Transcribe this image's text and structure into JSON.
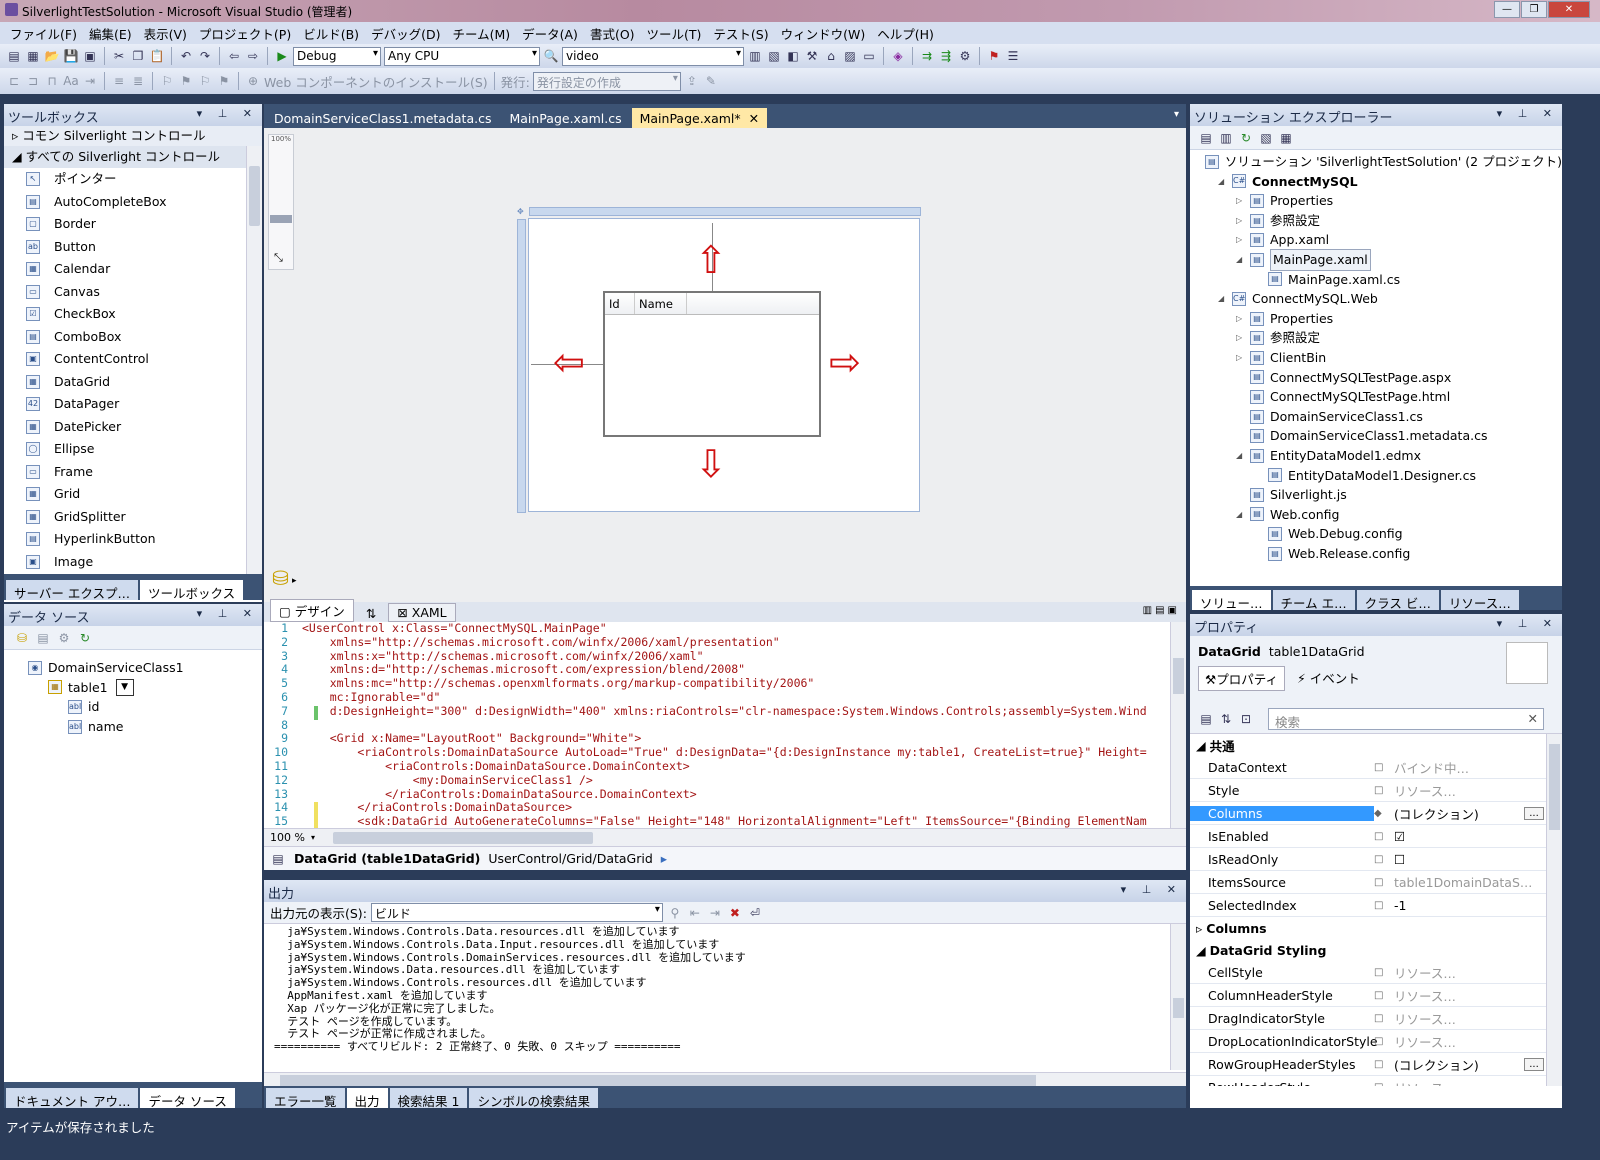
{
  "window": {
    "title": "SilverlightTestSolution - Microsoft Visual Studio (管理者)"
  },
  "menu": [
    "ファイル(F)",
    "編集(E)",
    "表示(V)",
    "プロジェクト(P)",
    "ビルド(B)",
    "デバッグ(D)",
    "チーム(M)",
    "データ(A)",
    "書式(O)",
    "ツール(T)",
    "テスト(S)",
    "ウィンドウ(W)",
    "ヘルプ(H)"
  ],
  "toolbar": {
    "config": "Debug",
    "platform": "Any CPU",
    "find": "video",
    "web_install": "Web コンポーネントのインストール(S)",
    "publish_label": "発行:",
    "publish_combo": "発行設定の作成"
  },
  "toolbox": {
    "title": "ツールボックス",
    "groups": [
      "コモン Silverlight コントロール",
      "すべての Silverlight コントロール"
    ],
    "items": [
      "ポインター",
      "AutoCompleteBox",
      "Border",
      "Button",
      "Calendar",
      "Canvas",
      "CheckBox",
      "ComboBox",
      "ContentControl",
      "DataGrid",
      "DataPager",
      "DatePicker",
      "Ellipse",
      "Frame",
      "Grid",
      "GridSplitter",
      "HyperlinkButton",
      "Image"
    ],
    "tabs": [
      "サーバー エクスプ…",
      "ツールボックス"
    ]
  },
  "datasource": {
    "title": "データ ソース",
    "tree": [
      "DomainServiceClass1",
      "table1",
      "id",
      "name"
    ],
    "tabs": [
      "ドキュメント アウ…",
      "データ ソース"
    ]
  },
  "editor": {
    "tabs": [
      "DomainServiceClass1.metadata.cs",
      "MainPage.xaml.cs",
      "MainPage.xaml*"
    ],
    "zoom_ruler": "100%",
    "grid_headers": [
      "Id",
      "Name"
    ],
    "view_tabs": [
      "デザイン",
      "⇅",
      "XAML"
    ],
    "zoom": "100 %",
    "lines": [
      {
        "n": "1",
        "t": "<UserControl x:Class=\"ConnectMySQL.MainPage\""
      },
      {
        "n": "2",
        "t": "    xmlns=\"http://schemas.microsoft.com/winfx/2006/xaml/presentation\""
      },
      {
        "n": "3",
        "t": "    xmlns:x=\"http://schemas.microsoft.com/winfx/2006/xaml\""
      },
      {
        "n": "4",
        "t": "    xmlns:d=\"http://schemas.microsoft.com/expression/blend/2008\""
      },
      {
        "n": "5",
        "t": "    xmlns:mc=\"http://schemas.openxmlformats.org/markup-compatibility/2006\""
      },
      {
        "n": "6",
        "t": "    mc:Ignorable=\"d\""
      },
      {
        "n": "7",
        "t": "    d:DesignHeight=\"300\" d:DesignWidth=\"400\" xmlns:riaControls=\"clr-namespace:System.Windows.Controls;assembly=System.Wind"
      },
      {
        "n": "8",
        "t": ""
      },
      {
        "n": "9",
        "t": "    <Grid x:Name=\"LayoutRoot\" Background=\"White\">"
      },
      {
        "n": "10",
        "t": "        <riaControls:DomainDataSource AutoLoad=\"True\" d:DesignData=\"{d:DesignInstance my:table1, CreateList=true}\" Height="
      },
      {
        "n": "11",
        "t": "            <riaControls:DomainDataSource.DomainContext>"
      },
      {
        "n": "12",
        "t": "                <my:DomainServiceClass1 />"
      },
      {
        "n": "13",
        "t": "            </riaControls:DomainDataSource.DomainContext>"
      },
      {
        "n": "14",
        "t": "        </riaControls:DomainDataSource>"
      },
      {
        "n": "15",
        "t": "        <sdk:DataGrid AutoGenerateColumns=\"False\" Height=\"148\" HorizontalAlignment=\"Left\" ItemsSource=\"{Binding ElementNam"
      }
    ],
    "breadcrumb_bold": "DataGrid (table1DataGrid)",
    "breadcrumb_path": "UserControl/Grid/DataGrid"
  },
  "output": {
    "title": "出力",
    "source_label": "出力元の表示(S):",
    "source": "ビルド",
    "lines": [
      "  ja¥System.Windows.Controls.Data.resources.dll を追加しています",
      "  ja¥System.Windows.Controls.Data.Input.resources.dll を追加しています",
      "  ja¥System.Windows.Controls.DomainServices.resources.dll を追加しています",
      "  ja¥System.Windows.Data.resources.dll を追加しています",
      "  ja¥System.Windows.Controls.resources.dll を追加しています",
      "  AppManifest.xaml を追加しています",
      "  Xap パッケージ化が正常に完了しました。",
      "  テスト ページを作成しています。",
      "  テスト ページが正常に作成されました。",
      "========== すべてリビルド: 2 正常終了、0 失敗、0 スキップ =========="
    ],
    "tabs": [
      "エラー一覧",
      "出力",
      "検索結果 1",
      "シンボルの検索結果"
    ]
  },
  "solution": {
    "title": "ソリューション エクスプローラー",
    "items": [
      {
        "t": "ソリューション 'SilverlightTestSolution' (2 プロジェクト)",
        "d": 0,
        "bold": false
      },
      {
        "t": "ConnectMySQL",
        "d": 1,
        "bold": true
      },
      {
        "t": "Properties",
        "d": 2,
        "bold": false
      },
      {
        "t": "参照設定",
        "d": 2,
        "bold": false
      },
      {
        "t": "App.xaml",
        "d": 2,
        "bold": false
      },
      {
        "t": "MainPage.xaml",
        "d": 2,
        "bold": false
      },
      {
        "t": "MainPage.xaml.cs",
        "d": 3,
        "bold": false
      },
      {
        "t": "ConnectMySQL.Web",
        "d": 1,
        "bold": false
      },
      {
        "t": "Properties",
        "d": 2,
        "bold": false
      },
      {
        "t": "参照設定",
        "d": 2,
        "bold": false
      },
      {
        "t": "ClientBin",
        "d": 2,
        "bold": false
      },
      {
        "t": "ConnectMySQLTestPage.aspx",
        "d": 2,
        "bold": false
      },
      {
        "t": "ConnectMySQLTestPage.html",
        "d": 2,
        "bold": false
      },
      {
        "t": "DomainServiceClass1.cs",
        "d": 2,
        "bold": false
      },
      {
        "t": "DomainServiceClass1.metadata.cs",
        "d": 2,
        "bold": false
      },
      {
        "t": "EntityDataModel1.edmx",
        "d": 2,
        "bold": false
      },
      {
        "t": "EntityDataModel1.Designer.cs",
        "d": 3,
        "bold": false
      },
      {
        "t": "Silverlight.js",
        "d": 2,
        "bold": false
      },
      {
        "t": "Web.config",
        "d": 2,
        "bold": false
      },
      {
        "t": "Web.Debug.config",
        "d": 3,
        "bold": false
      },
      {
        "t": "Web.Release.config",
        "d": 3,
        "bold": false
      }
    ],
    "tabs": [
      "ソリュー…",
      "チーム エ…",
      "クラス ビ…",
      "リソース…"
    ]
  },
  "properties": {
    "title": "プロパティ",
    "type": "DataGrid",
    "name": "table1DataGrid",
    "tabs": [
      "プロパティ",
      "イベント"
    ],
    "search_placeholder": "検索",
    "cat_common": "共通",
    "common": [
      {
        "n": "DataContext",
        "v": "バインド中…"
      },
      {
        "n": "Style",
        "v": "リソース…"
      },
      {
        "n": "Columns",
        "v": "(コレクション)"
      },
      {
        "n": "IsEnabled",
        "v": "☑"
      },
      {
        "n": "IsReadOnly",
        "v": "☐"
      },
      {
        "n": "ItemsSource",
        "v": "table1DomainDataS…"
      },
      {
        "n": "SelectedIndex",
        "v": "-1"
      }
    ],
    "cat_columns": "Columns",
    "cat_styling": "DataGrid Styling",
    "styling": [
      {
        "n": "CellStyle",
        "v": "リソース…"
      },
      {
        "n": "ColumnHeaderStyle",
        "v": "リソース…"
      },
      {
        "n": "DragIndicatorStyle",
        "v": "リソース…"
      },
      {
        "n": "DropLocationIndicatorStyle",
        "v": "リソース…"
      },
      {
        "n": "RowGroupHeaderStyles",
        "v": "(コレクション)"
      },
      {
        "n": "RowHeaderStyle",
        "v": "リソース…"
      }
    ]
  },
  "status": {
    "text": "アイテムが保存されました"
  }
}
